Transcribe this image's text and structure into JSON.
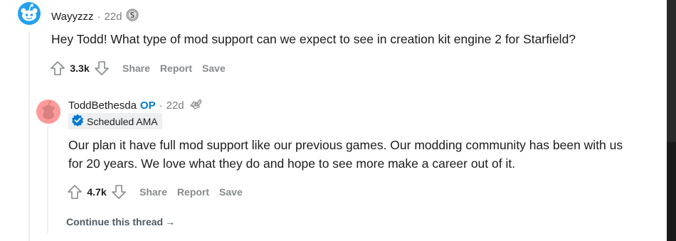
{
  "colors": {
    "op": "#0079d3",
    "muted": "#7c7c7c",
    "action": "#878a8c",
    "flair_bg": "#edeff1",
    "page_bg": "#dae0e6"
  },
  "comments": [
    {
      "author": "Wayyzzz",
      "time": "22d",
      "avatar_icon": "snoo-avatar-icon",
      "award_icon": "silver-coin-award-icon",
      "text": "Hey Todd! What type of mod support can we expect to see in creation kit engine 2 for Starfield?",
      "score": "3.3k",
      "actions": {
        "share": "Share",
        "report": "Report",
        "save": "Save"
      }
    },
    {
      "author": "ToddBethesda",
      "op_badge": "OP",
      "time": "22d",
      "avatar_icon": "snoo-avatar-icon",
      "award_icon": "helpful-award-icon",
      "flair": "Scheduled AMA",
      "flair_icon": "verified-check-icon",
      "text": "Our plan it have full mod support like our previous games. Our modding community has been with us for 20 years. We love what they do and hope to see more make a career out of it.",
      "score": "4.7k",
      "actions": {
        "share": "Share",
        "report": "Report",
        "save": "Save"
      }
    }
  ],
  "continue_thread": "Continue this thread",
  "continue_arrow": "→"
}
